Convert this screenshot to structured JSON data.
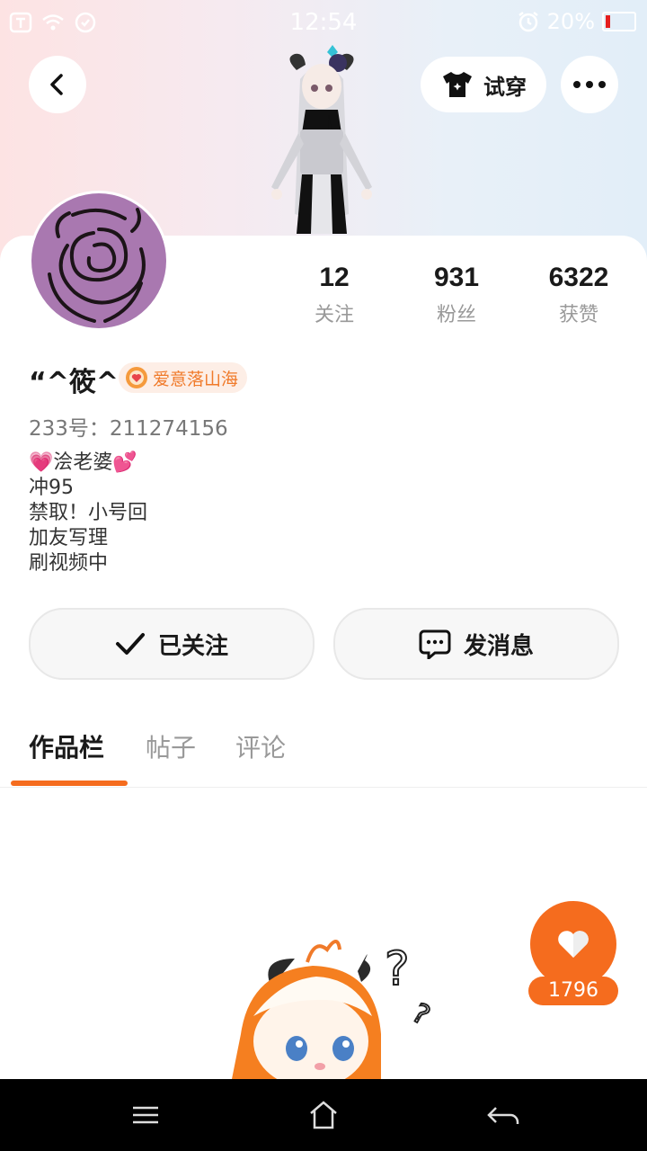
{
  "status_bar": {
    "time": "12:54",
    "battery": "20%"
  },
  "header": {
    "try_on_label": "试穿"
  },
  "profile": {
    "stats": [
      {
        "count": "12",
        "label": "关注"
      },
      {
        "count": "931",
        "label": "粉丝"
      },
      {
        "count": "6322",
        "label": "获赞"
      }
    ],
    "username": "“^筱^",
    "badge_label": "爱意落山海",
    "uid": "233号：211274156",
    "bio": [
      "💗浍老婆💕",
      "冲95",
      "禁取！小号回",
      "加友写理",
      "刷视频中"
    ]
  },
  "actions": {
    "follow_label": "已关注",
    "message_label": "发消息"
  },
  "tabs": [
    {
      "label": "作品栏",
      "active": true
    },
    {
      "label": "帖子",
      "active": false
    },
    {
      "label": "评论",
      "active": false
    }
  ],
  "like": {
    "count": "1796"
  },
  "colors": {
    "accent": "#f56c1e",
    "badge_text": "#f07a2a",
    "avatar_rose": "#a978b0"
  },
  "icons": [
    "back-icon",
    "t-shirt-icon",
    "more-icon",
    "check-icon",
    "chat-bubble-icon",
    "heart-icon",
    "menu-icon",
    "home-icon",
    "back-arrow-icon"
  ]
}
